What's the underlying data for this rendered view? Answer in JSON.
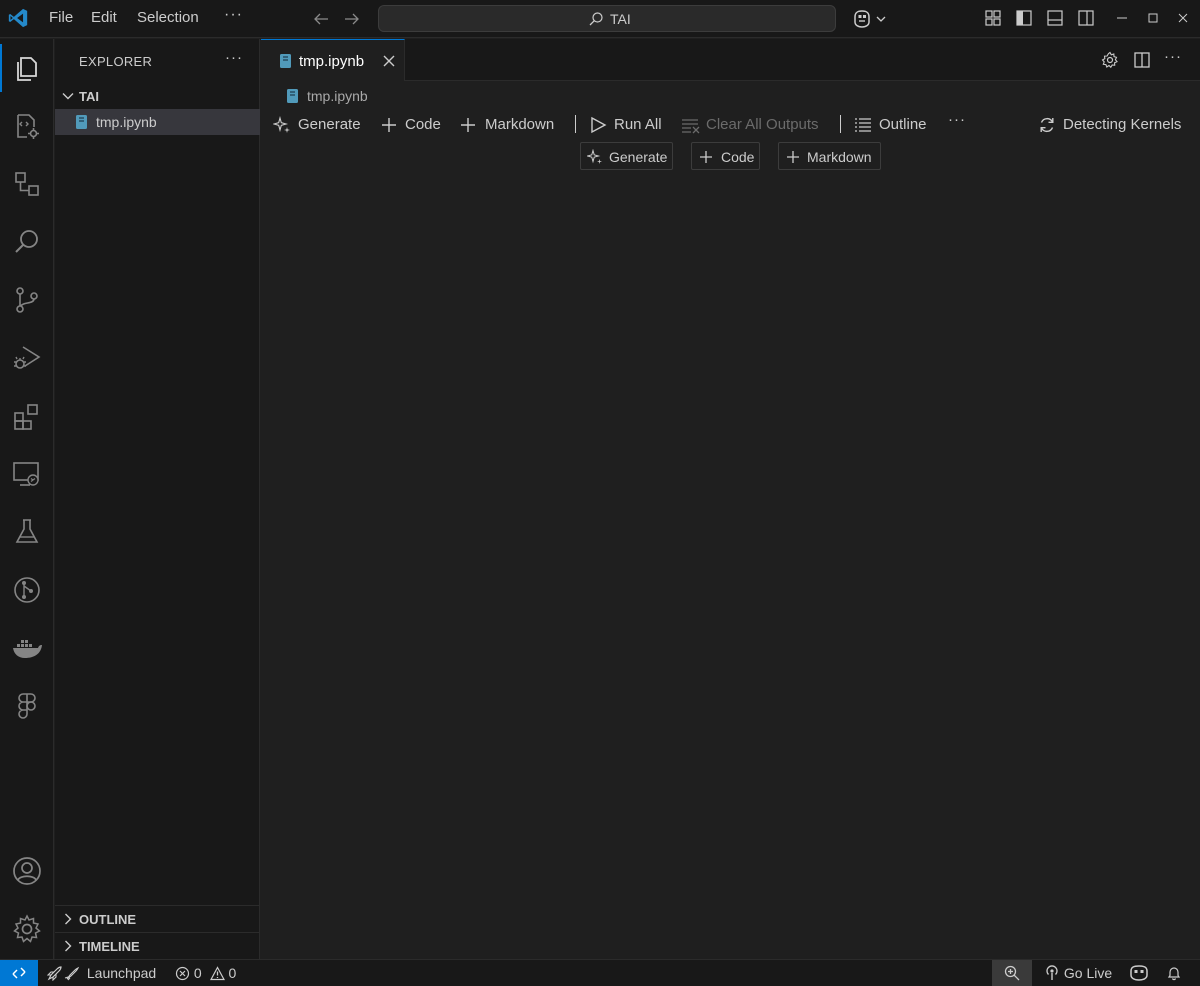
{
  "titlebar": {
    "menu": [
      "File",
      "Edit",
      "Selection"
    ],
    "more": "···",
    "command_center": "TAI"
  },
  "activity_bar": {
    "items": [
      "explorer",
      "remote-explorer",
      "source-control-graph",
      "search",
      "source-control",
      "run-and-debug",
      "extensions",
      "remote",
      "testing",
      "git-graph",
      "docker",
      "figma"
    ],
    "bottom": [
      "accounts",
      "manage"
    ],
    "active": "explorer"
  },
  "sidebar": {
    "title": "EXPLORER",
    "more": "···",
    "folder": "TAI",
    "files": [
      "tmp.ipynb"
    ],
    "sections": [
      "OUTLINE",
      "TIMELINE"
    ]
  },
  "editor": {
    "tab": "tmp.ipynb",
    "more": "···",
    "breadcrumb": "tmp.ipynb",
    "toolbar": {
      "generate": "Generate",
      "code": "Code",
      "markdown": "Markdown",
      "run_all": "Run All",
      "clear_all_outputs": "Clear All Outputs",
      "outline": "Outline",
      "more": "···",
      "kernel": "Detecting Kernels"
    },
    "cell_actions": {
      "generate": "Generate",
      "code": "Code",
      "markdown": "Markdown"
    }
  },
  "statusbar": {
    "launchpad": "Launchpad",
    "errors": "0",
    "warnings": "0",
    "go_live": "Go Live"
  },
  "colors": {
    "accent": "#0078d4",
    "notebook_icon": "#519aba",
    "background": "#1f1f1f",
    "chrome": "#181818"
  }
}
